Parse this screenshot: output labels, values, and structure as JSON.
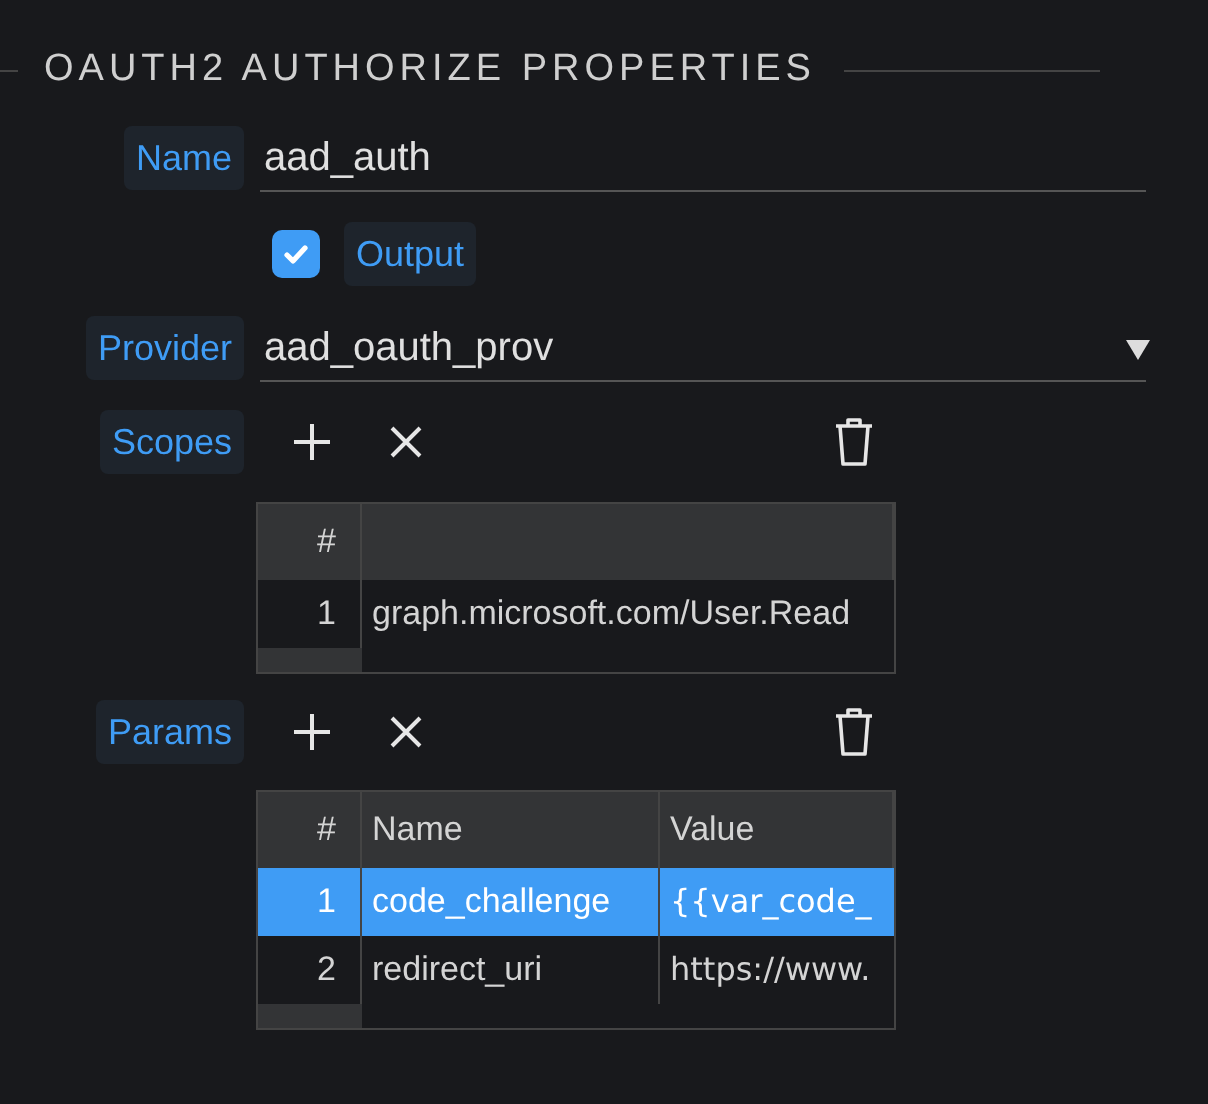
{
  "section_title": "OAUTH2 AUTHORIZE PROPERTIES",
  "name": {
    "label": "Name",
    "value": "aad_auth"
  },
  "output": {
    "label": "Output",
    "checked": true
  },
  "provider": {
    "label": "Provider",
    "value": "aad_oauth_prov"
  },
  "scopes": {
    "label": "Scopes",
    "columns": [
      "#"
    ],
    "rows": [
      {
        "cells": [
          "1",
          "graph.microsoft.com/User.Read"
        ],
        "selected": false
      }
    ]
  },
  "params": {
    "label": "Params",
    "columns": [
      "#",
      "Name",
      "Value"
    ],
    "rows": [
      {
        "cells": [
          "1",
          "code_challenge",
          "{{var_code_"
        ],
        "selected": true
      },
      {
        "cells": [
          "2",
          "redirect_uri",
          "https://www."
        ],
        "selected": false
      }
    ]
  }
}
